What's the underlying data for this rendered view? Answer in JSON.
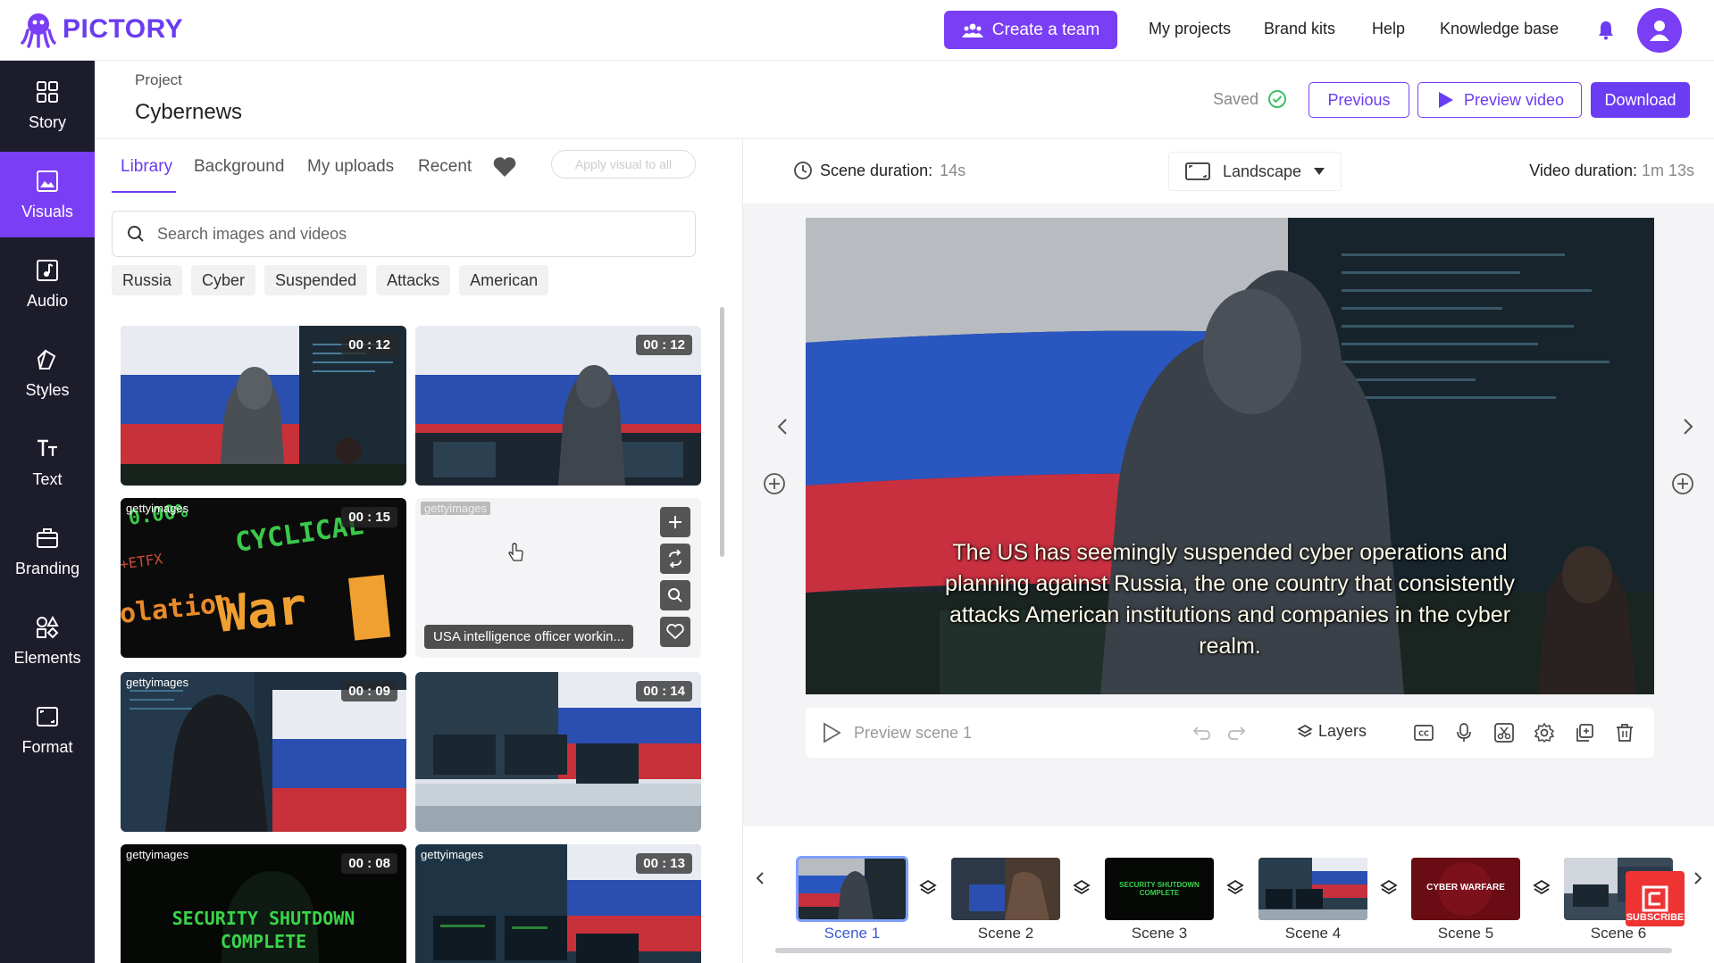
{
  "app": {
    "brand": "PICTORY"
  },
  "topnav": {
    "create_team": "Create a team",
    "links": [
      "My projects",
      "Brand kits",
      "Help",
      "Knowledge base"
    ]
  },
  "sidebar": {
    "items": [
      {
        "label": "Story",
        "icon": "grid-icon"
      },
      {
        "label": "Visuals",
        "icon": "image-icon",
        "active": true
      },
      {
        "label": "Audio",
        "icon": "music-icon"
      },
      {
        "label": "Styles",
        "icon": "styles-icon"
      },
      {
        "label": "Text",
        "icon": "text-icon"
      },
      {
        "label": "Branding",
        "icon": "briefcase-icon"
      },
      {
        "label": "Elements",
        "icon": "shapes-icon"
      },
      {
        "label": "Format",
        "icon": "format-icon"
      }
    ]
  },
  "project": {
    "label": "Project",
    "name": "Cybernews",
    "saved": "Saved",
    "previous": "Previous",
    "preview_video": "Preview video",
    "download": "Download"
  },
  "library": {
    "tabs": [
      "Library",
      "Background",
      "My uploads",
      "Recent"
    ],
    "apply_all": "Apply visual to all",
    "search_placeholder": "Search images and videos",
    "chips": [
      "Russia",
      "Cyber",
      "Suspended",
      "Attacks",
      "American"
    ],
    "thumbs": [
      {
        "duration": "00 : 12",
        "getty": ""
      },
      {
        "duration": "00 : 12",
        "getty": ""
      },
      {
        "duration": "00 : 15",
        "getty": "gettyimages"
      },
      {
        "duration": "",
        "getty": "gettyimages",
        "caption": "USA intelligence officer workin..."
      },
      {
        "duration": "00 : 09",
        "getty": "gettyimages"
      },
      {
        "duration": "00 : 14",
        "getty": ""
      },
      {
        "duration": "00 : 08",
        "getty": "gettyimages",
        "overlay": "SECURITY SHUTDOWN COMPLETE"
      },
      {
        "duration": "00 : 13",
        "getty": "gettyimages"
      }
    ],
    "ticker_text": [
      "CYCLICAL",
      "War",
      "olation",
      "0.00%",
      "+ETFX"
    ]
  },
  "editor": {
    "scene_duration_label": "Scene duration:",
    "scene_duration": "14s",
    "orientation": "Landscape",
    "video_duration_label": "Video duration:",
    "video_duration": "1m 13s",
    "caption": "The US has seemingly suspended cyber operations and planning against Russia, the one country that consistently attacks American institutions and companies in the cyber realm.",
    "preview_scene": "Preview scene 1",
    "layers": "Layers"
  },
  "timeline": {
    "scenes": [
      {
        "label": "Scene 1",
        "active": true,
        "overlay": ""
      },
      {
        "label": "Scene 2",
        "overlay": ""
      },
      {
        "label": "Scene 3",
        "overlay": "SECURITY SHUTDOWN COMPLETE"
      },
      {
        "label": "Scene 4",
        "overlay": ""
      },
      {
        "label": "Scene 5",
        "overlay": "CYBER WARFARE"
      },
      {
        "label": "Scene 6",
        "overlay": ""
      }
    ],
    "subscribe": "SUBSCRIBE"
  },
  "colors": {
    "accent": "#7a3ef5",
    "sidebar": "#1c1c2b"
  }
}
